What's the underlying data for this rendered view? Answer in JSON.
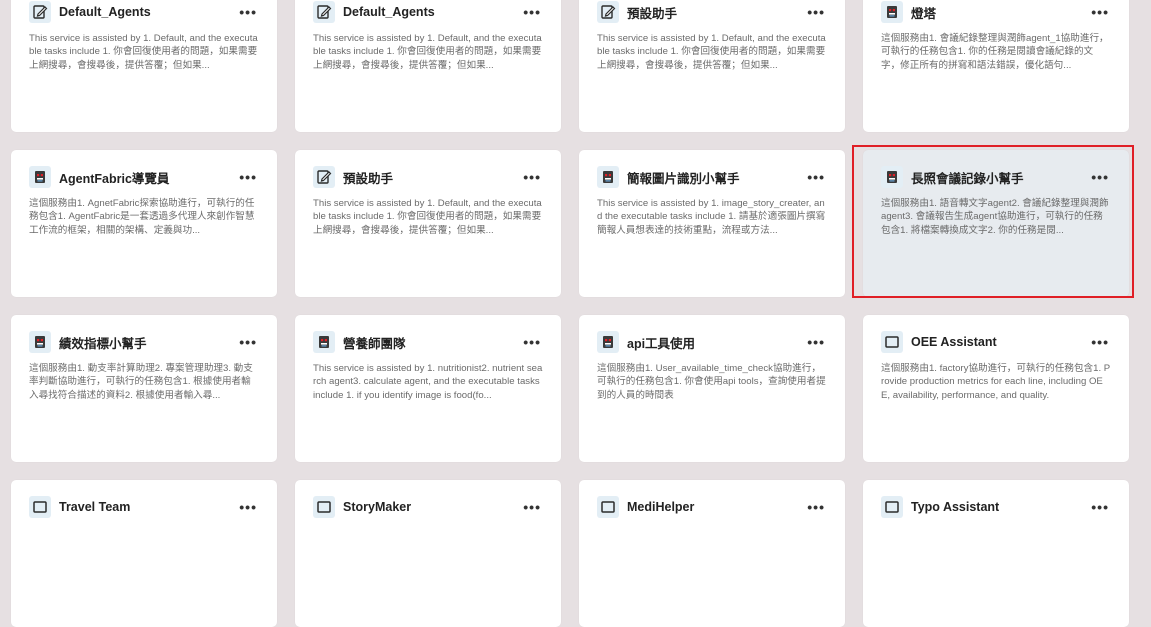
{
  "more_label": "•••",
  "accent_color": "#e01f26",
  "cards": [
    {
      "name": "Default_Agents",
      "icon": "notepad-icon",
      "desc": "This service is assisted by 1. Default, and the executable tasks include 1. 你會回復使用者的問題，如果需要上網搜尋，會搜尋後，提供答覆；但如果..."
    },
    {
      "name": "Default_Agents",
      "icon": "notepad-icon",
      "desc": "This service is assisted by 1. Default, and the executable tasks include 1. 你會回復使用者的問題，如果需要上網搜尋，會搜尋後，提供答覆；但如果..."
    },
    {
      "name": "預設助手",
      "icon": "notepad-icon",
      "desc": "This service is assisted by 1. Default, and the executable tasks include 1. 你會回復使用者的問題，如果需要上網搜尋，會搜尋後，提供答覆；但如果..."
    },
    {
      "name": "燈塔",
      "icon": "robot-icon",
      "desc": "這個服務由1. 會議紀錄整理與潤飾agent_1協助進行，可執行的任務包含1. 你的任務是閱讀會議紀錄的文字，修正所有的拼寫和語法錯誤，優化語句..."
    },
    {
      "name": "AgentFabric導覽員",
      "icon": "robot-icon",
      "desc": "這個服務由1. AgnetFabric探索協助進行，可執行的任務包含1. AgentFabric是一套透過多代理人來創作智慧工作流的框架，相關的架構、定義與功..."
    },
    {
      "name": "預設助手",
      "icon": "notepad-icon",
      "desc": "This service is assisted by 1. Default, and the executable tasks include 1. 你會回復使用者的問題，如果需要上網搜尋，會搜尋後，提供答覆；但如果..."
    },
    {
      "name": "簡報圖片識別小幫手",
      "icon": "robot-icon",
      "desc": "This service is assisted by 1. image_story_creater, and the executable tasks include 1. 請基於適張圖片撰寫簡報人員想表達的技術重點，流程或方法..."
    },
    {
      "name": "長照會議記錄小幫手",
      "icon": "robot-icon",
      "selected": true,
      "desc": "這個服務由1. 語音轉文字agent2. 會議紀錄整理與潤飾agent3. 會議報告生成agent協助進行，可執行的任務包含1. 將檔案轉換成文字2. 你的任務是閱..."
    },
    {
      "name": "績效指標小幫手",
      "icon": "robot-icon",
      "desc": "這個服務由1. 動支率計算助理2. 專案管理助理3. 動支率判斷協助進行，可執行的任務包含1. 根據使用者輸入尋找符合描述的資料2. 根據使用者輸入尋..."
    },
    {
      "name": "營養師團隊",
      "icon": "robot-icon",
      "desc": "This service is assisted by 1. nutritionist2. nutrient search agent3. calculate agent, and the executable tasks include 1. if you identify image is food(fo..."
    },
    {
      "name": "api工具使用",
      "icon": "robot-icon",
      "desc": "這個服務由1. User_available_time_check協助進行，可執行的任務包含1. 你會使用api tools，查詢使用者提到的人員的時間表"
    },
    {
      "name": "OEE Assistant",
      "icon": "window-icon",
      "desc": "這個服務由1. factory協助進行，可執行的任務包含1. Provide production metrics for each line, including OEE, availability, performance, and quality."
    },
    {
      "name": "Travel Team",
      "icon": "window-icon",
      "desc": ""
    },
    {
      "name": "StoryMaker",
      "icon": "window-icon",
      "desc": ""
    },
    {
      "name": "MediHelper",
      "icon": "window-icon",
      "desc": ""
    },
    {
      "name": "Typo Assistant",
      "icon": "window-icon",
      "desc": ""
    }
  ]
}
